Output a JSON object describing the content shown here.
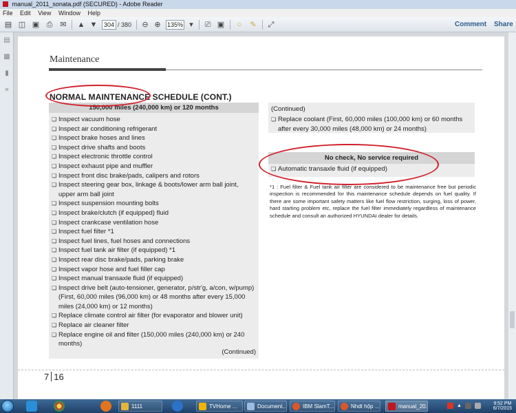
{
  "window": {
    "title": "manual_2011_sonata.pdf (SECURED) - Adobe Reader"
  },
  "menu": [
    "File",
    "Edit",
    "View",
    "Window",
    "Help"
  ],
  "toolbar": {
    "page_current": "304",
    "page_total": "/ 380",
    "zoom": "135%",
    "comment_label": "Comment",
    "share_label": "Share"
  },
  "document": {
    "section_header": "Maintenance",
    "title": "NORMAL MAINTENANCE SCHEDULE (CONT.)",
    "left_column": {
      "header": "150,000 miles (240,000 km) or 120 months",
      "items": [
        "Inspect vacuum hose",
        "Inspect air conditioning refrigerant",
        "Inspect brake hoses and lines",
        "Inspect drive shafts and boots",
        "Inspect electronic throttle control",
        "Inspect exhaust pipe and muffler",
        "Inspect front disc brake/pads, calipers and rotors",
        "Inspect steering gear box, linkage & boots/lower arm ball joint, upper arm ball joint",
        "Inspect suspension mounting bolts",
        "Inspect brake/clutch (if equipped) fluid",
        "Inspect crankcase ventilation hose",
        "Inspect fuel filter *1",
        "Inspect fuel lines, fuel hoses and connections",
        "Inspect fuel tank air filter (if equipped) *1",
        "Inspect rear disc brake/pads, parking brake",
        "Inspect vapor hose and fuel filler cap",
        "Inspect manual transaxle fluid (if equipped)",
        "Inspect drive belt (auto-tensioner, generator, p/str'g, a/con, w/pump) (First, 60,000 miles (96,000 km) or 48 months after every 15,000 miles (24,000 km) or 12 months)",
        "Replace climate control air filter (for evaporator and blower unit)",
        "Replace air cleaner filter",
        "Replace engine oil and filter (150,000 miles (240,000 km) or 240 months)"
      ],
      "continued": "(Continued)"
    },
    "right_column": {
      "continued_head": "(Continued)",
      "items": [
        "Replace coolant (First, 60,000 miles (100,000 km) or 60 months after every 30,000 miles (48,000 km) or 24 months)"
      ],
      "no_service_header": "No check, No service required",
      "no_service_items": [
        "Automatic transaxle fluid (if equipped)"
      ],
      "footnote": "*1 : Fuel filter & Fuel tank air filter are considered to be maintenance free but periodic inspection is recommended for this maintenance schedule depends on fuel quality. If there are some important safety matters like fuel flow restriction, surging, loss of power, hard starting problem etc, replace the fuel filter immediately regardless of maintenance schedule and consult an authorized HYUNDAI dealer for details."
    },
    "page_number_chapter": "7",
    "page_number": "16"
  },
  "taskbar": {
    "items": [
      {
        "label": "1111",
        "color": "#e5b53a"
      },
      {
        "label": "TVHome ...",
        "color": "#f1b400"
      },
      {
        "label": "Document...",
        "color": "#9dbce0"
      },
      {
        "label": "IBM SlamT...",
        "color": "#d8582a"
      },
      {
        "label": "Nhdt hộp ...",
        "color": "#d8582a"
      },
      {
        "label": "manual_20...",
        "color": "#c0161c"
      }
    ],
    "time": "9:52 PM",
    "date": "6/7/2015"
  },
  "colors": {
    "annotation_red": "#d0202a",
    "link_blue": "#2c5b8c"
  }
}
